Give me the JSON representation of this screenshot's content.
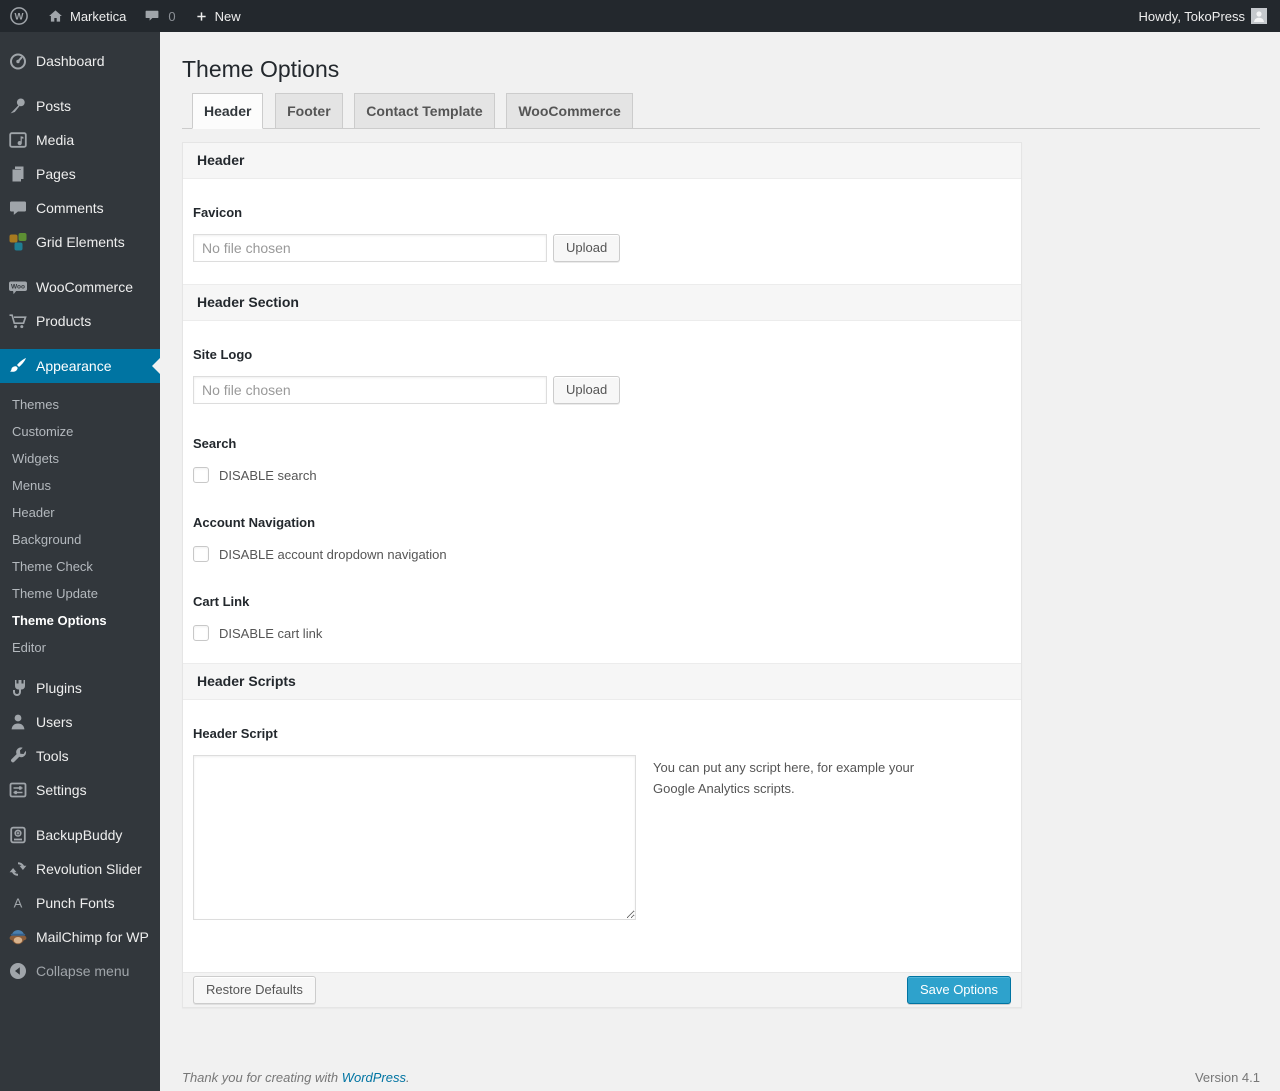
{
  "admin_bar": {
    "site_name": "Marketica",
    "comment_count": "0",
    "new_label": "New",
    "howdy": "Howdy, TokoPress"
  },
  "sidebar": {
    "menu_top": [
      {
        "label": "Dashboard"
      },
      {
        "label": "Posts"
      },
      {
        "label": "Media"
      },
      {
        "label": "Pages"
      },
      {
        "label": "Comments"
      },
      {
        "label": "Grid Elements"
      },
      {
        "label": "WooCommerce"
      },
      {
        "label": "Products"
      },
      {
        "label": "Appearance"
      }
    ],
    "appearance_submenu": [
      {
        "label": "Themes"
      },
      {
        "label": "Customize"
      },
      {
        "label": "Widgets"
      },
      {
        "label": "Menus"
      },
      {
        "label": "Header"
      },
      {
        "label": "Background"
      },
      {
        "label": "Theme Check"
      },
      {
        "label": "Theme Update"
      },
      {
        "label": "Theme Options",
        "current": true
      },
      {
        "label": "Editor"
      }
    ],
    "menu_bottom": [
      {
        "label": "Plugins"
      },
      {
        "label": "Users"
      },
      {
        "label": "Tools"
      },
      {
        "label": "Settings"
      },
      {
        "label": "BackupBuddy"
      },
      {
        "label": "Revolution Slider"
      },
      {
        "label": "Punch Fonts"
      },
      {
        "label": "MailChimp for WP"
      }
    ],
    "collapse_label": "Collapse menu"
  },
  "content": {
    "title": "Theme Options",
    "tabs": [
      {
        "label": "Header",
        "active": true
      },
      {
        "label": "Footer"
      },
      {
        "label": "Contact Template"
      },
      {
        "label": "WooCommerce"
      }
    ],
    "header_section": {
      "title": "Header",
      "favicon_label": "Favicon",
      "favicon_value": "No file chosen",
      "upload_label": "Upload"
    },
    "header_section2": {
      "title": "Header Section",
      "site_logo_label": "Site Logo",
      "site_logo_value": "No file chosen",
      "upload_label": "Upload",
      "search_label": "Search",
      "search_checkbox_label": "DISABLE search",
      "account_label": "Account Navigation",
      "account_checkbox_label": "DISABLE account dropdown navigation",
      "cart_label": "Cart Link",
      "cart_checkbox_label": "DISABLE cart link"
    },
    "scripts_section": {
      "title": "Header Scripts",
      "script_label": "Header Script",
      "script_value": "",
      "help_text": "You can put any script here, for example your Google Analytics scripts."
    },
    "footer_bar": {
      "restore_label": "Restore Defaults",
      "save_label": "Save Options"
    }
  },
  "page_footer": {
    "thanks_prefix": "Thank you for creating with ",
    "wordpress_link": "WordPress",
    "thanks_suffix": ".",
    "version": "Version 4.1"
  },
  "colors": {
    "admin_bar_bg": "#23282d",
    "menu_bg": "#32373c",
    "active_menu_blue": "#0074a2",
    "primary_button_blue": "#2ea2cc",
    "page_bg": "#f1f1f1",
    "link_blue": "#0074a2",
    "icon_gray": "#a0a5aa"
  }
}
